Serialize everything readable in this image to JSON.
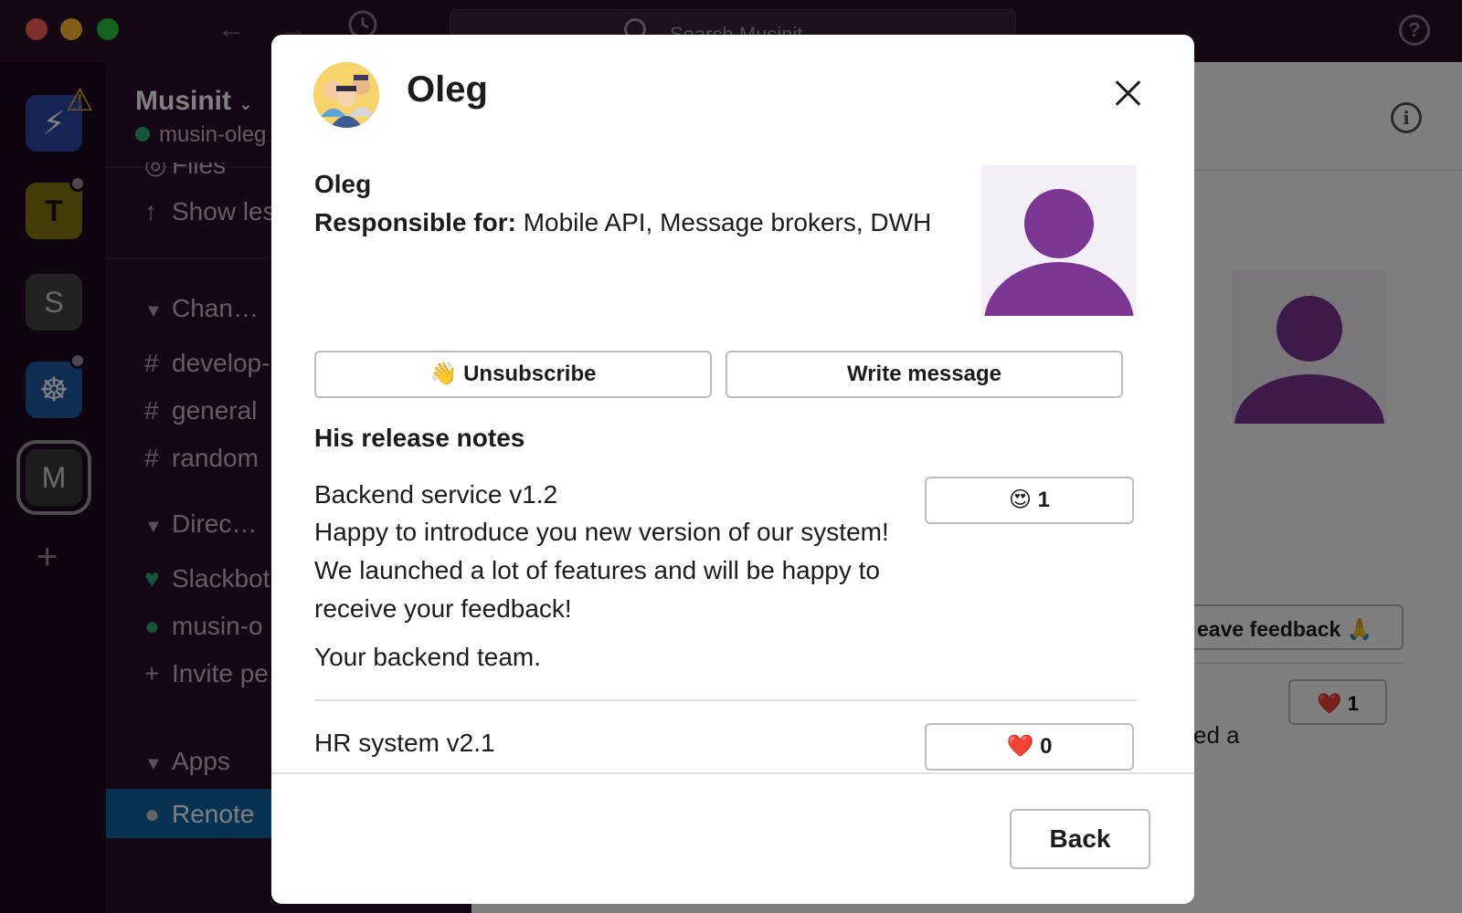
{
  "topbar": {
    "search_placeholder": "Search Musinit",
    "back_icon": "arrow-left-icon",
    "forward_icon": "arrow-right-icon",
    "history_icon": "clock-icon",
    "help_icon": "help-icon"
  },
  "rail": {
    "workspaces": [
      {
        "letter": "⚡",
        "icon": "lightning-icon"
      },
      {
        "letter": "T",
        "icon": "t-logo-icon"
      },
      {
        "letter": "S",
        "icon": "s-workspace-icon"
      },
      {
        "letter": "☸",
        "icon": "helm-icon"
      },
      {
        "letter": "M",
        "icon": "m-workspace-icon"
      }
    ],
    "add_label": "+"
  },
  "sidebar": {
    "workspace_name": "Musinit",
    "user": "musin-oleg",
    "items": {
      "files": "Files",
      "show_less": "Show less",
      "channels_header": "Chan…",
      "channel_1": "develop-",
      "channel_2": "general",
      "channel_3": "random",
      "direct_header": "Direc…",
      "dm_1": "Slackbot",
      "dm_2": "musin-o",
      "invite": "Invite pe",
      "apps_header": "Apps",
      "app_1": "Renote"
    }
  },
  "background_pane": {
    "feedback_button": "eave feedback 🙏",
    "heart_reaction": "❤️ 1",
    "fragment_text": "ed a"
  },
  "modal": {
    "title": "Oleg",
    "name": "Oleg",
    "responsible_label": "Responsible for:",
    "responsible_value": " Mobile API, Message brokers, DWH",
    "unsubscribe_label": "👋 Unsubscribe",
    "write_message_label": "Write message",
    "section_title": "His release notes",
    "notes": [
      {
        "title": "Backend service v1.2",
        "body": "Happy to introduce you new version of our system! We launched a lot of features and will be happy to receive your feedback!",
        "sign": "Your backend team.",
        "reaction": "😍 1"
      },
      {
        "title": "HR system v2.1",
        "body": "",
        "sign": "",
        "reaction": "❤️ 0"
      }
    ],
    "back_label": "Back"
  },
  "colors": {
    "sidebar_bg": "#2d0f2e",
    "active_item": "#1164a3",
    "avatar_purple": "#7b3593",
    "online": "#2bac76"
  }
}
